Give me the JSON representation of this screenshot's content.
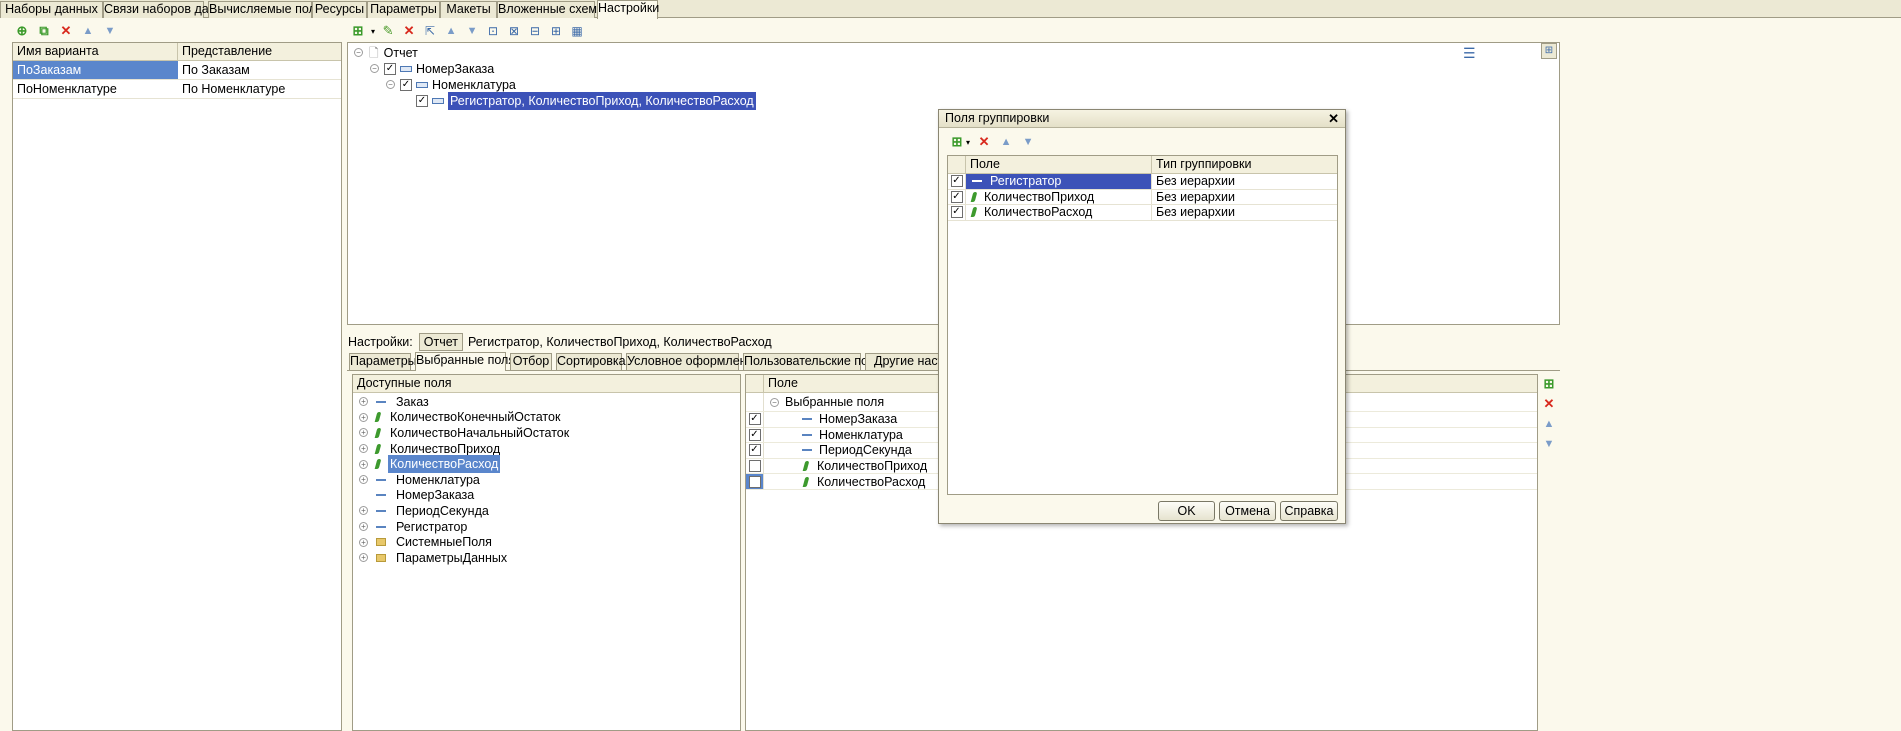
{
  "top_tabs": [
    "Наборы данных",
    "Связи наборов данных",
    "Вычисляемые поля",
    "Ресурсы",
    "Параметры",
    "Макеты",
    "Вложенные схемы",
    "Настройки"
  ],
  "variants": {
    "headers": [
      "Имя варианта",
      "Представление"
    ],
    "rows": [
      {
        "name": "ПоЗаказам",
        "view": "По Заказам"
      },
      {
        "name": "ПоНоменклатуре",
        "view": "По Номенклатуре"
      }
    ]
  },
  "structure": {
    "root": "Отчет",
    "level1": "НомерЗаказа",
    "level2": "Номенклатура",
    "level3": "Регистратор, КоличествоПриход, КоличествоРасход"
  },
  "settings_line": {
    "label": "Настройки:",
    "button": "Отчет",
    "value": "Регистратор, КоличествоПриход, КоличествоРасход"
  },
  "sub_tabs": [
    "Параметры",
    "Выбранные поля",
    "Отбор",
    "Сортировка",
    "Условное оформление",
    "Пользовательские поля",
    "Другие настро"
  ],
  "available_fields": {
    "header": "Доступные поля",
    "items": [
      "Заказ",
      "КоличествоКонечныйОстаток",
      "КоличествоНачальныйОстаток",
      "КоличествоПриход",
      "КоличествоРасход",
      "Номенклатура",
      "НомерЗаказа",
      "ПериодСекунда",
      "Регистратор",
      "СистемныеПоля",
      "ПараметрыДанных"
    ]
  },
  "selected_fields": {
    "header": "Поле",
    "group": "Выбранные поля",
    "items": [
      "НомерЗаказа",
      "Номенклатура",
      "ПериодСекунда",
      "КоличествоПриход",
      "КоличествоРасход"
    ]
  },
  "dialog": {
    "title": "Поля группировки",
    "close": "✕",
    "headers": [
      "Поле",
      "Тип группировки"
    ],
    "rows": [
      {
        "field": "Регистратор",
        "type": "Без иерархии"
      },
      {
        "field": "КоличествоПриход",
        "type": "Без иерархии"
      },
      {
        "field": "КоличествоРасход",
        "type": "Без иерархии"
      }
    ],
    "ok": "OK",
    "cancel": "Отмена",
    "help": "Справка"
  }
}
